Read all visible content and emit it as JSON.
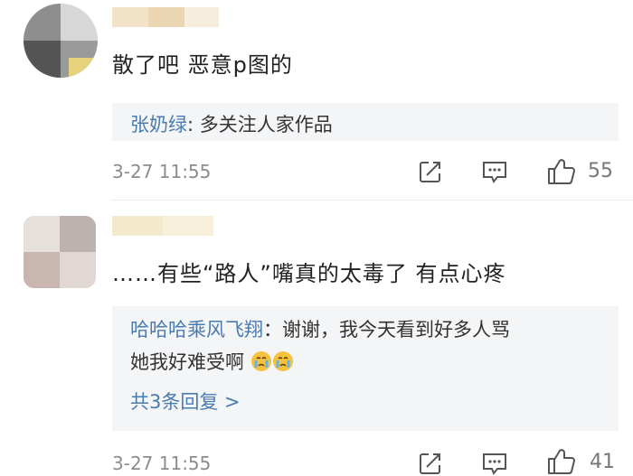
{
  "comments": [
    {
      "text": "散了吧 恶意p图的",
      "reply": {
        "author": "张奶绿",
        "sep": ": ",
        "text": "多关注人家作品"
      },
      "time": "3-27 11:55",
      "likes": "55"
    },
    {
      "text": "……有些“路人”嘴真的太毒了  有点心疼",
      "reply": {
        "author": "哈哈哈乘风飞翔",
        "sep": "：",
        "text": "谢谢，我今天看到好多人骂",
        "text2": "她我好难受啊",
        "more": "共3条回复 >"
      },
      "time": "3-27 11:55",
      "likes": "41"
    }
  ],
  "icons": [
    "share-icon",
    "comment-icon",
    "like-icon",
    "crying-emoji-icon"
  ],
  "colors": {
    "link": "#4a7bb0",
    "reply_bg": "#f4f5f7",
    "meta": "#8c8c8c"
  }
}
